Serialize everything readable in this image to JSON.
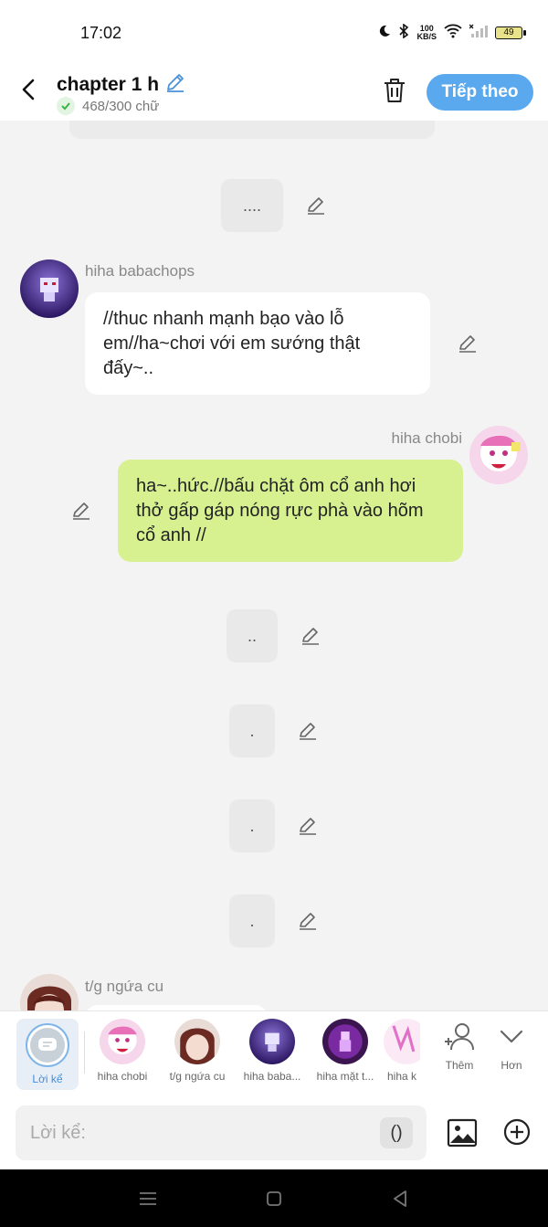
{
  "status": {
    "time": "17:02",
    "speed_top": "100",
    "speed_bottom": "KB/S",
    "battery": "49"
  },
  "header": {
    "title": "chapter 1 h",
    "word_count": "468/300 chữ",
    "next_label": "Tiếp theo"
  },
  "messages": {
    "narr1": "....",
    "m1_sender": "hiha babachops",
    "m1_text": "//thuc nhanh mạnh bạo vào lỗ em//ha~chơi với em sướng thật đấy~..",
    "m2_sender": "hiha chobi",
    "m2_text": "ha~..hức.//bấu chặt ôm cổ anh hơi thở gấp gáp nóng rực phà vào hõm cổ anh //",
    "narr2": "..",
    "narr3": ".",
    "narr4": ".",
    "narr5": ".",
    "m3_sender": "t/g ngứa cu"
  },
  "characters": {
    "narrator": "Lời kể",
    "c1": "hiha chobi",
    "c2": "t/g ngứa cu",
    "c3": "hiha baba...",
    "c4": "hiha mặt t...",
    "c5": "hiha k",
    "add": "Thêm",
    "more": "Hơn"
  },
  "input": {
    "placeholder": "Lời kể:",
    "paren": "()"
  },
  "colors": {
    "accent": "#5aa9ee",
    "right_bubble": "#d7f191",
    "left_bubble": "#ffffff"
  }
}
